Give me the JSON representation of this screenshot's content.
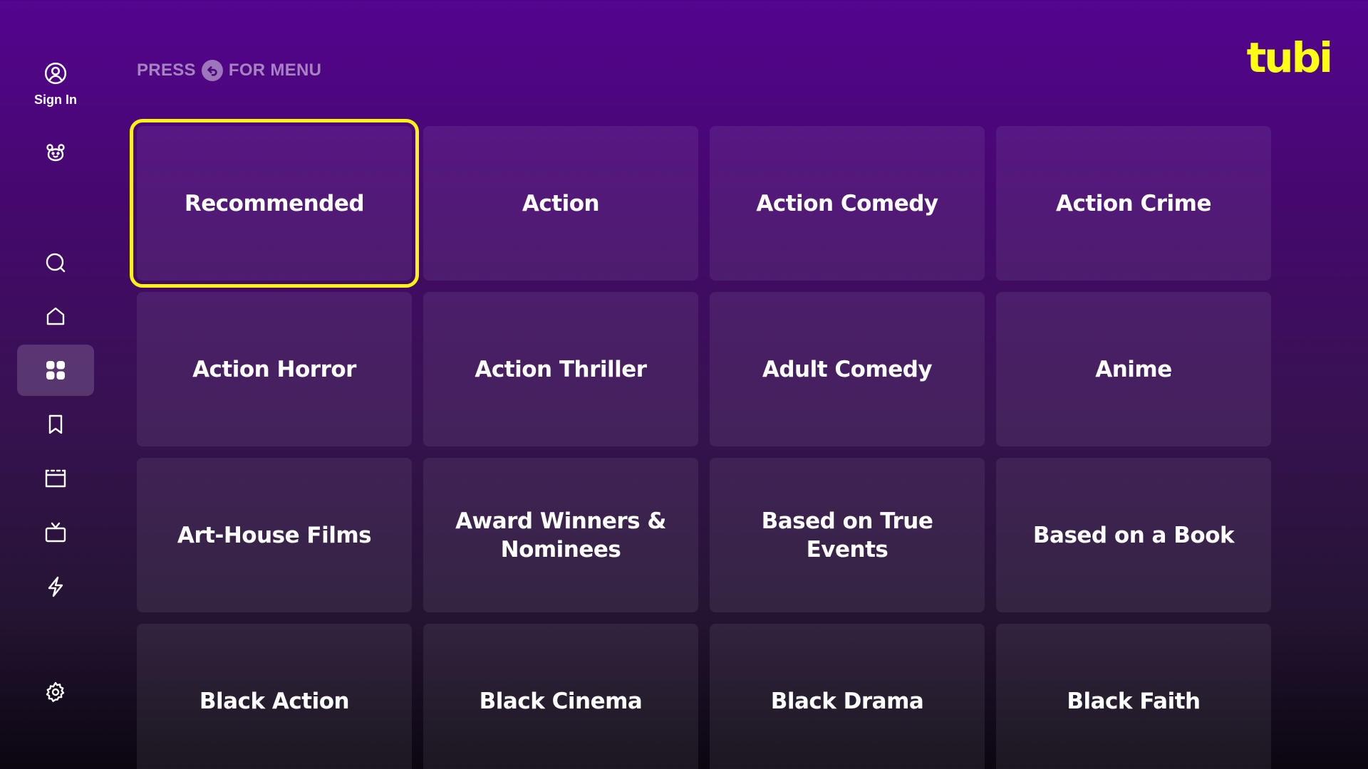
{
  "sidebar": {
    "sign_in_label": "Sign In",
    "items": [
      {
        "icon": "kids-icon",
        "label": "Kids"
      },
      {
        "icon": "search-icon",
        "label": "Search"
      },
      {
        "icon": "home-icon",
        "label": "Home"
      },
      {
        "icon": "categories-icon",
        "label": "Categories",
        "active": true
      },
      {
        "icon": "bookmark-icon",
        "label": "My List"
      },
      {
        "icon": "movies-icon",
        "label": "Movies"
      },
      {
        "icon": "tv-icon",
        "label": "TV Shows"
      },
      {
        "icon": "lightning-icon",
        "label": "Live"
      },
      {
        "icon": "gear-icon",
        "label": "Settings"
      }
    ]
  },
  "header": {
    "hint_prefix": "PRESS",
    "hint_suffix": "FOR MENU",
    "logo_text": "tubi"
  },
  "categories": [
    "Recommended",
    "Action",
    "Action Comedy",
    "Action Crime",
    "Action Horror",
    "Action Thriller",
    "Adult Comedy",
    "Anime",
    "Art-House Films",
    "Award Winners & Nominees",
    "Based on True Events",
    "Based on a Book",
    "Black Action",
    "Black Cinema",
    "Black Drama",
    "Black Faith"
  ],
  "focused_category": "Recommended",
  "colors": {
    "accent": "#fff016",
    "logo": "#ffff13",
    "background_top": "#54048f",
    "background_bottom": "#0b0610"
  }
}
